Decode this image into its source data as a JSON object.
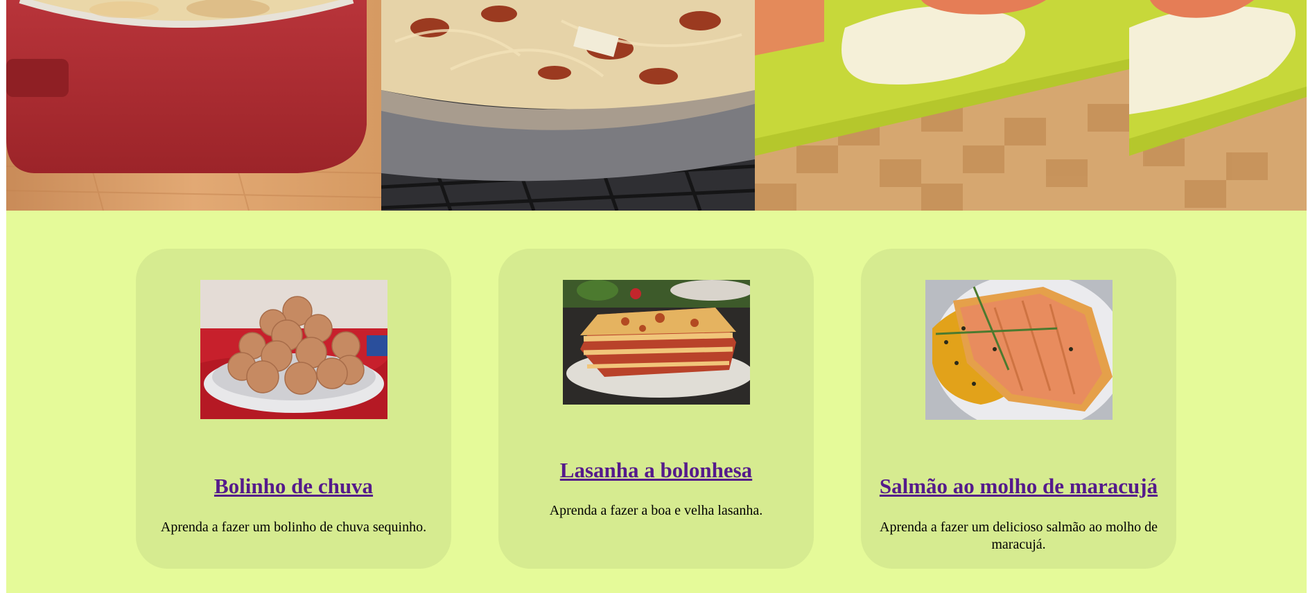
{
  "hero": {
    "panels": [
      {
        "icon": "casserole-dish-image"
      },
      {
        "icon": "carbonara-pasta-image"
      },
      {
        "icon": "salmon-cream-sauce-image"
      },
      {
        "icon": "salmon-cream-sauce-image"
      }
    ]
  },
  "recipes": [
    {
      "title": "Bolinho de chuva",
      "description": "Aprenda a fazer um bolinho de chuva sequinho.",
      "image_icon": "rain-cookies-photo"
    },
    {
      "title": "Lasanha a bolonhesa",
      "description": "Aprenda a fazer a boa e velha lasanha.",
      "image_icon": "lasagna-photo"
    },
    {
      "title": "Salmão ao molho de maracujá",
      "description": "Aprenda a fazer um delicioso salmão ao molho de maracujá.",
      "image_icon": "salmon-passionfruit-photo"
    }
  ],
  "colors": {
    "page_background": "#e5fa99",
    "card_background": "#d6eb90",
    "link_visited": "#551a8b",
    "text": "#000000"
  }
}
